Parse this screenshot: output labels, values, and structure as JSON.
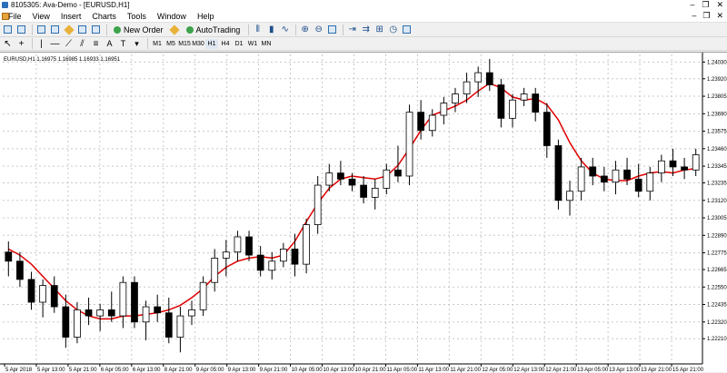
{
  "window": {
    "title": "8105305: Ava-Demo - [EURUSD,H1]",
    "controls": [
      "–",
      "❐",
      "✕"
    ]
  },
  "menu": {
    "items": [
      "File",
      "View",
      "Insert",
      "Charts",
      "Tools",
      "Window",
      "Help"
    ],
    "mdi_controls": [
      "–",
      "❐",
      "✕"
    ]
  },
  "toolbar": {
    "new_order_label": "New Order",
    "autotrading_label": "AutoTrading",
    "timeframes": [
      "M1",
      "M5",
      "M15",
      "M30",
      "H1",
      "H4",
      "D1",
      "W1",
      "MN"
    ]
  },
  "chart": {
    "symbol_label": "EURUSD,H1  1.16975 1.16985 1.16933 1.16951"
  },
  "chart_data": {
    "type": "candlestick",
    "symbol": "EURUSD",
    "timeframe": "H1",
    "ohlc_header": {
      "open": 1.16975,
      "high": 1.16985,
      "low": 1.16933,
      "close": 1.16951
    },
    "ylim": [
      1.2205,
      1.2408
    ],
    "y_ticks": [
      1.2403,
      1.2392,
      1.23805,
      1.2369,
      1.23575,
      1.2346,
      1.23345,
      1.23235,
      1.2312,
      1.23005,
      1.2289,
      1.22775,
      1.22665,
      1.2255,
      1.22435,
      1.2232,
      1.2221
    ],
    "x_labels": [
      "5 Apr 2018",
      "5 Apr 13:00",
      "5 Apr 21:00",
      "6 Apr 05:00",
      "6 Apr 13:00",
      "8 Apr 21:00",
      "9 Apr 05:00",
      "9 Apr 13:00",
      "9 Apr 21:00",
      "10 Apr 05:00",
      "10 Apr 13:00",
      "10 Apr 21:00",
      "11 Apr 05:00",
      "11 Apr 13:00",
      "11 Apr 21:00",
      "12 Apr 05:00",
      "12 Apr 13:00",
      "12 Apr 21:00",
      "13 Apr 05:00",
      "13 Apr 13:00",
      "13 Apr 21:00",
      "15 Apr 21:00"
    ],
    "moving_average": {
      "color": "#e00000",
      "values": [
        1.228,
        1.2276,
        1.227,
        1.2262,
        1.2254,
        1.2246,
        1.224,
        1.2236,
        1.2234,
        1.2234,
        1.2236,
        1.2236,
        1.2237,
        1.2238,
        1.224,
        1.2243,
        1.2248,
        1.2254,
        1.2262,
        1.2268,
        1.2272,
        1.2274,
        1.2275,
        1.2274,
        1.2276,
        1.2285,
        1.2298,
        1.231,
        1.232,
        1.2326,
        1.2328,
        1.2327,
        1.2326,
        1.2328,
        1.2335,
        1.2346,
        1.2358,
        1.2368,
        1.2371,
        1.2374,
        1.2378,
        1.2384,
        1.2389,
        1.2386,
        1.238,
        1.2378,
        1.2379,
        1.2375,
        1.2365,
        1.235,
        1.2338,
        1.233,
        1.2326,
        1.2325,
        1.2325,
        1.2328,
        1.233,
        1.2331,
        1.233,
        1.2332,
        1.2333
      ]
    },
    "candles": [
      [
        1.2278,
        1.2285,
        1.2262,
        1.2272
      ],
      [
        1.2272,
        1.2278,
        1.2255,
        1.226
      ],
      [
        1.226,
        1.2265,
        1.224,
        1.2245
      ],
      [
        1.2245,
        1.226,
        1.2235,
        1.2256
      ],
      [
        1.2256,
        1.2262,
        1.2238,
        1.2242
      ],
      [
        1.2242,
        1.225,
        1.2215,
        1.2222
      ],
      [
        1.2222,
        1.2245,
        1.2218,
        1.224
      ],
      [
        1.224,
        1.2248,
        1.223,
        1.2236
      ],
      [
        1.2236,
        1.2244,
        1.2226,
        1.224
      ],
      [
        1.224,
        1.2252,
        1.2232,
        1.2236
      ],
      [
        1.2236,
        1.2262,
        1.2228,
        1.2258
      ],
      [
        1.2258,
        1.2262,
        1.2228,
        1.2232
      ],
      [
        1.2232,
        1.2246,
        1.222,
        1.2242
      ],
      [
        1.2242,
        1.225,
        1.2232,
        1.2238
      ],
      [
        1.2238,
        1.2248,
        1.2218,
        1.2222
      ],
      [
        1.2222,
        1.2242,
        1.2212,
        1.2236
      ],
      [
        1.2236,
        1.2246,
        1.223,
        1.224
      ],
      [
        1.224,
        1.2262,
        1.2236,
        1.2258
      ],
      [
        1.2258,
        1.228,
        1.2252,
        1.2274
      ],
      [
        1.2274,
        1.2286,
        1.2262,
        1.2278
      ],
      [
        1.2278,
        1.2292,
        1.2272,
        1.2288
      ],
      [
        1.2288,
        1.2292,
        1.2272,
        1.2276
      ],
      [
        1.2276,
        1.2282,
        1.2262,
        1.2266
      ],
      [
        1.2266,
        1.2278,
        1.226,
        1.2272
      ],
      [
        1.2272,
        1.2284,
        1.2268,
        1.228
      ],
      [
        1.228,
        1.229,
        1.2262,
        1.227
      ],
      [
        1.227,
        1.23,
        1.2264,
        1.2296
      ],
      [
        1.2296,
        1.2328,
        1.229,
        1.2322
      ],
      [
        1.2322,
        1.2336,
        1.2318,
        1.233
      ],
      [
        1.233,
        1.2338,
        1.2322,
        1.2326
      ],
      [
        1.2326,
        1.233,
        1.2318,
        1.2322
      ],
      [
        1.2322,
        1.2328,
        1.231,
        1.2314
      ],
      [
        1.2314,
        1.2326,
        1.2306,
        1.232
      ],
      [
        1.232,
        1.2336,
        1.2316,
        1.2332
      ],
      [
        1.2332,
        1.2348,
        1.2324,
        1.2328
      ],
      [
        1.2328,
        1.2375,
        1.2322,
        1.237
      ],
      [
        1.237,
        1.2378,
        1.2352,
        1.2358
      ],
      [
        1.2358,
        1.2372,
        1.2354,
        1.2368
      ],
      [
        1.2368,
        1.238,
        1.2362,
        1.2376
      ],
      [
        1.2376,
        1.2386,
        1.237,
        1.2382
      ],
      [
        1.2382,
        1.2396,
        1.2376,
        1.239
      ],
      [
        1.239,
        1.24,
        1.238,
        1.2396
      ],
      [
        1.2396,
        1.2405,
        1.2384,
        1.2388
      ],
      [
        1.2388,
        1.2392,
        1.236,
        1.2366
      ],
      [
        1.2366,
        1.2382,
        1.236,
        1.2378
      ],
      [
        1.2378,
        1.2386,
        1.2374,
        1.2382
      ],
      [
        1.2382,
        1.2386,
        1.2364,
        1.237
      ],
      [
        1.237,
        1.2376,
        1.234,
        1.2348
      ],
      [
        1.2348,
        1.2352,
        1.2306,
        1.2312
      ],
      [
        1.2312,
        1.2325,
        1.2302,
        1.2318
      ],
      [
        1.2318,
        1.234,
        1.2312,
        1.2334
      ],
      [
        1.2334,
        1.234,
        1.2322,
        1.2328
      ],
      [
        1.2328,
        1.2334,
        1.2318,
        1.2324
      ],
      [
        1.2324,
        1.2338,
        1.2316,
        1.2332
      ],
      [
        1.2332,
        1.234,
        1.2322,
        1.2326
      ],
      [
        1.2326,
        1.2336,
        1.2314,
        1.2318
      ],
      [
        1.2318,
        1.2334,
        1.2312,
        1.233
      ],
      [
        1.233,
        1.2342,
        1.2324,
        1.2338
      ],
      [
        1.2338,
        1.2346,
        1.2328,
        1.2334
      ],
      [
        1.2334,
        1.234,
        1.2326,
        1.2332
      ],
      [
        1.2332,
        1.2346,
        1.2328,
        1.2342
      ]
    ]
  }
}
